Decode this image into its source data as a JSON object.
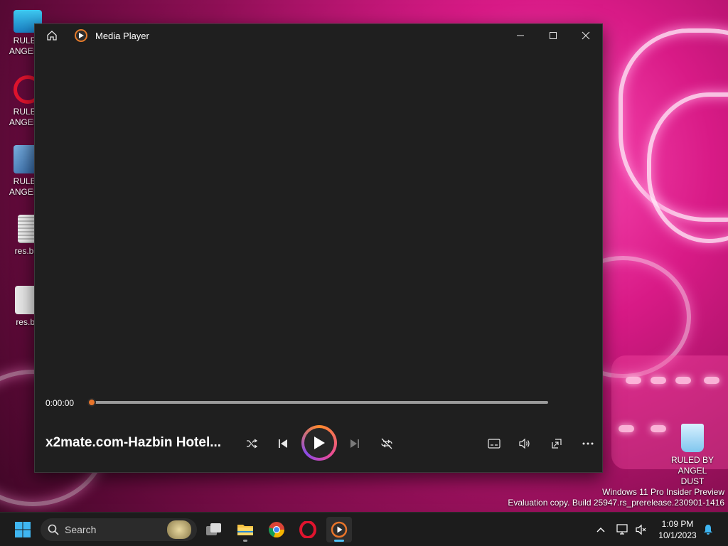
{
  "desktop": {
    "icons": [
      {
        "label_line1": "RULED",
        "label_line2": "ANGEL D",
        "icon": "monitor-icon"
      },
      {
        "label_line1": "RULED",
        "label_line2": "ANGEL D",
        "icon": "opera-shortcut-icon"
      },
      {
        "label_line1": "RULED",
        "label_line2": "ANGEL D",
        "icon": "virtualbox-shortcut-icon"
      },
      {
        "label_line1": "res.bat",
        "label_line2": "",
        "icon": "batch-file-icon"
      },
      {
        "label_line1": "res.ba",
        "label_line2": "",
        "icon": "settings-file-icon"
      }
    ],
    "recycle_bin": {
      "label_line1": "RULED BY",
      "label_line2": "ANGEL DUST",
      "icon": "recycle-bin-icon"
    },
    "watermark": {
      "line1": "Windows 11 Pro Insider Preview",
      "line2": "Evaluation copy. Build 25947.rs_prerelease.230901-1416"
    }
  },
  "window": {
    "title": "Media Player",
    "accent": "#e8742a",
    "player": {
      "current_time": "0:00:00",
      "progress": 0,
      "track_title": "x2mate.com-Hazbin Hotel..."
    }
  },
  "taskbar": {
    "search_placeholder": "Search",
    "clock_time": "1:09 PM",
    "clock_date": "10/1/2023"
  }
}
